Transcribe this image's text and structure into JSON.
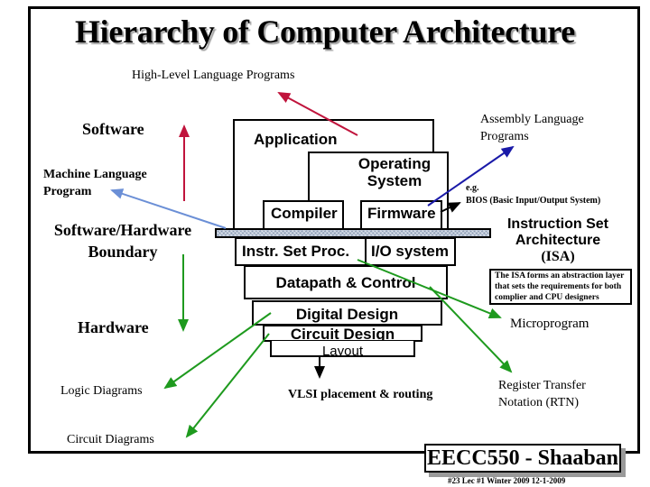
{
  "title": "Hierarchy of Computer Architecture",
  "labels": {
    "high_level": "High-Level Language Programs",
    "software": "Software",
    "machine_language": [
      "Machine Language",
      "Program"
    ],
    "boundary": [
      "Software/Hardware",
      "Boundary"
    ],
    "hardware": "Hardware",
    "logic_diagrams": "Logic Diagrams",
    "circuit_diagrams": "Circuit Diagrams",
    "assembly": [
      "Assembly Language",
      "Programs"
    ],
    "bios": [
      "e.g.",
      "BIOS (Basic Input/Output System)"
    ],
    "isa": [
      "Instruction Set",
      "Architecture",
      "(ISA)"
    ],
    "microprogram": "Microprogram",
    "vlsi": "VLSI placement & routing",
    "rtn": [
      "Register Transfer",
      "Notation (RTN)"
    ]
  },
  "layers": {
    "application": "Application",
    "operating_system": [
      "Operating",
      "System"
    ],
    "compiler": "Compiler",
    "firmware": "Firmware",
    "instr_set_proc": "Instr. Set Proc.",
    "io_system": "I/O system",
    "datapath": "Datapath & Control",
    "digital_design": "Digital Design",
    "circuit_design": "Circuit Design",
    "layout": "Layout"
  },
  "isa_note": [
    "The ISA forms an abstraction layer",
    "that sets the requirements for both",
    "complier and CPU designers"
  ],
  "footer": {
    "course": "EECC550 - Shaaban",
    "meta": "#23   Lec #1  Winter 2009  12-1-2009"
  },
  "colors": {
    "software_arrow": "#c0143c",
    "assembly_arrow": "#1a1aa8",
    "machine_arrow": "#6b8fd6",
    "hardware_arrow": "#1e9a1e",
    "boundary_fill": "#b8c4d6"
  }
}
